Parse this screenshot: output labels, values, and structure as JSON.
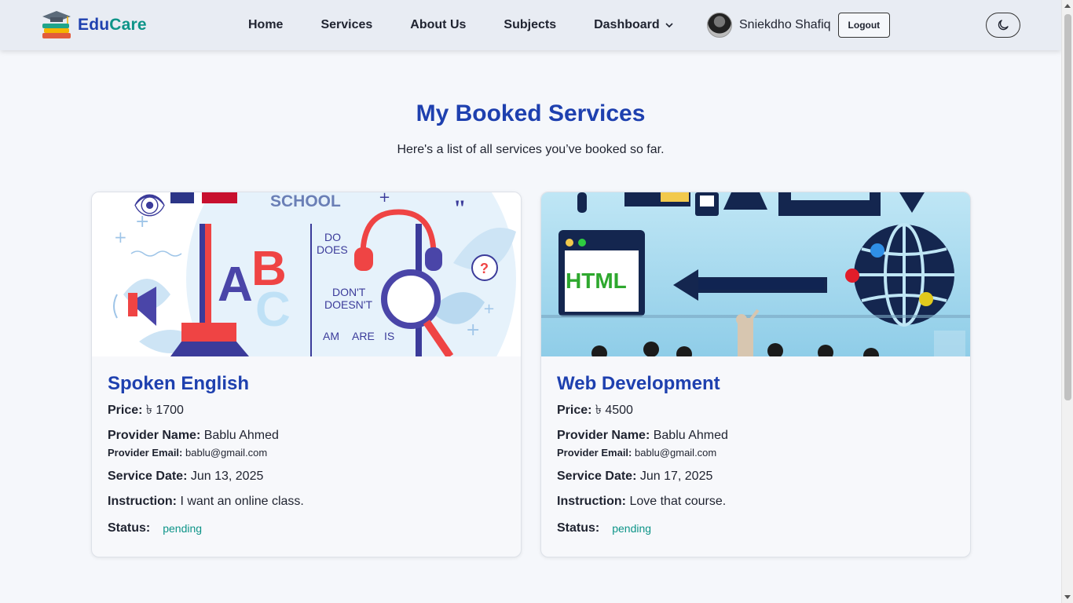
{
  "nav": {
    "brand_part1": "Edu",
    "brand_part2": "Care",
    "links": [
      "Home",
      "Services",
      "About Us",
      "Subjects",
      "Dashboard"
    ],
    "user_name": "Sniekdho Shafiq",
    "logout_label": "Logout",
    "theme_icon": "moon-icon"
  },
  "header": {
    "title": "My Booked Services",
    "subtitle": "Here's a list of all services you’ve booked so far."
  },
  "labels": {
    "price": "Price:",
    "provider_name": "Provider Name:",
    "provider_email": "Provider Email:",
    "service_date": "Service Date:",
    "instruction": "Instruction:",
    "status": "Status:"
  },
  "bookings": [
    {
      "title": "Spoken English",
      "price": "৳ 1700",
      "provider_name": "Bablu Ahmed",
      "provider_email": "bablu@gmail.com",
      "service_date": "Jun 13, 2025",
      "instruction": "I want an online class.",
      "status": "pending",
      "image_text": {
        "school": "SCHOOL",
        "do": "DO",
        "does": "DOES",
        "dont": "DON'T",
        "doesnt": "DOESN'T",
        "am": "AM",
        "are": "ARE",
        "is": "IS",
        "a": "A",
        "b": "B",
        "c": "C"
      }
    },
    {
      "title": "Web Development",
      "price": "৳ 4500",
      "provider_name": "Bablu Ahmed",
      "provider_email": "bablu@gmail.com",
      "service_date": "Jun 17, 2025",
      "instruction": "Love that course.",
      "status": "pending",
      "image_text": {
        "html": "HTML"
      }
    }
  ],
  "colors": {
    "primary": "#1e40af",
    "teal": "#0d9488",
    "background": "#f5f7fb",
    "navbar": "#e8ecf3"
  }
}
